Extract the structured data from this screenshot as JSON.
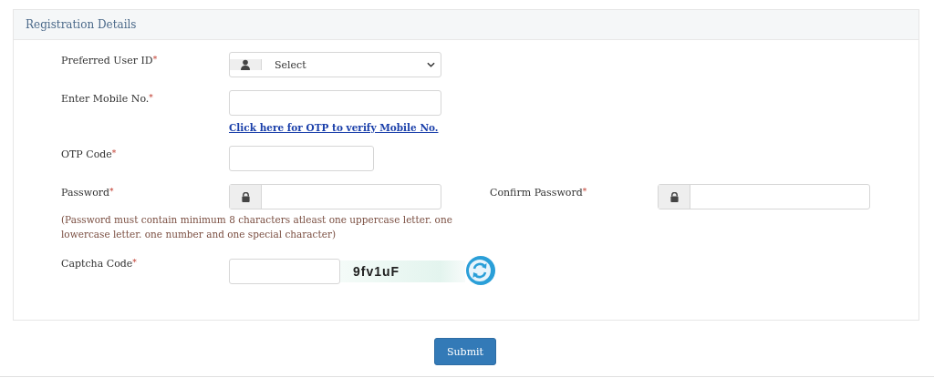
{
  "panel": {
    "title": "Registration Details"
  },
  "fields": [
    {
      "kind": "select",
      "label": "Preferred User ID",
      "mark": "*",
      "value": "Select"
    },
    {
      "kind": "text",
      "label": "Enter Mobile No.",
      "mark": "*",
      "link": "Click here for OTP to verify Mobile No."
    },
    {
      "kind": "short",
      "label": "OTP Code",
      "mark": "*"
    },
    {
      "kind": "password",
      "label": "Password",
      "mark": "*",
      "hint": "(Password must contain minimum 8 characters atleast one uppercase letter. one lowercase letter. one number and one special character)",
      "confirm_label": "Confirm Password",
      "confirm_mark": "*"
    },
    {
      "kind": "captcha",
      "label": "Captcha Code",
      "mark": "*",
      "captcha": "9fv1uF"
    }
  ],
  "submit": "Submit"
}
